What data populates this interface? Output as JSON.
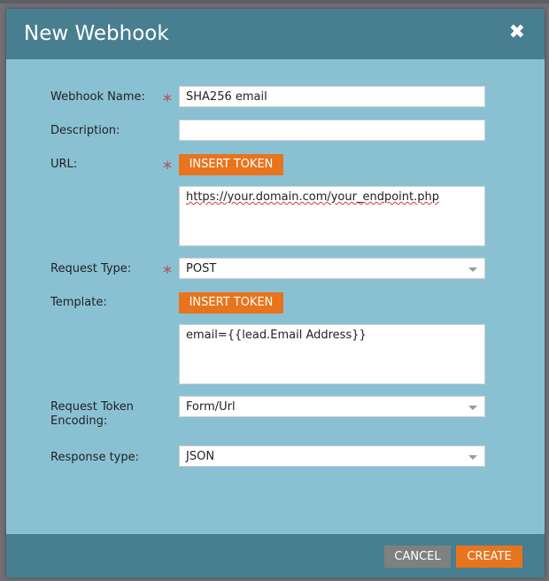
{
  "dialog": {
    "title": "New Webhook",
    "close_icon": "close-icon",
    "fields": {
      "name_label": "Webhook Name:",
      "name_value": "SHA256 email",
      "description_label": "Description:",
      "description_value": "",
      "url_label": "URL:",
      "insert_token": "INSERT TOKEN",
      "url_value": "https://your.domain.com/your_endpoint.php",
      "request_type_label": "Request Type:",
      "request_type_value": "POST",
      "template_label": "Template:",
      "template_value": "email={{lead.Email Address}}",
      "encoding_label": "Request Token Encoding:",
      "encoding_value": "Form/Url",
      "response_label": "Response type:",
      "response_value": "JSON"
    },
    "footer": {
      "cancel": "CANCEL",
      "create": "CREATE"
    },
    "colors": {
      "header": "#477f90",
      "body": "#89c1d3",
      "accent": "#e8741d",
      "cancel": "#808080",
      "required": "#b0504a"
    }
  }
}
